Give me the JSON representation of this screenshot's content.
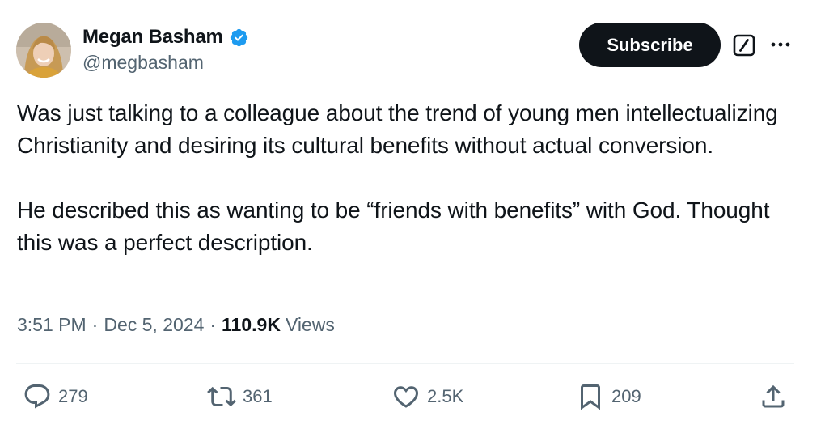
{
  "author": {
    "display_name": "Megan Basham",
    "handle": "@megbasham",
    "verified": true,
    "verified_color": "#1d9bf0"
  },
  "header_actions": {
    "subscribe_label": "Subscribe",
    "grok_icon": "grok-icon",
    "more_icon": "more-dots-icon"
  },
  "tweet": {
    "paragraphs": [
      "Was just talking to a colleague about the trend of young men intellectualizing Christianity and desiring its cultural benefits without actual conversion.",
      "He described this as wanting to be “friends with benefits” with God. Thought this was a perfect description."
    ]
  },
  "meta": {
    "time": "3:51 PM",
    "separator": "·",
    "date": "Dec 5, 2024",
    "views_count": "110.9K",
    "views_label": "Views"
  },
  "actions": {
    "replies": "279",
    "reposts": "361",
    "likes": "2.5K",
    "bookmarks": "209"
  },
  "colors": {
    "text_primary": "#0f1419",
    "text_secondary": "#536471",
    "button_bg": "#0f1419",
    "divider": "#eff3f4"
  }
}
